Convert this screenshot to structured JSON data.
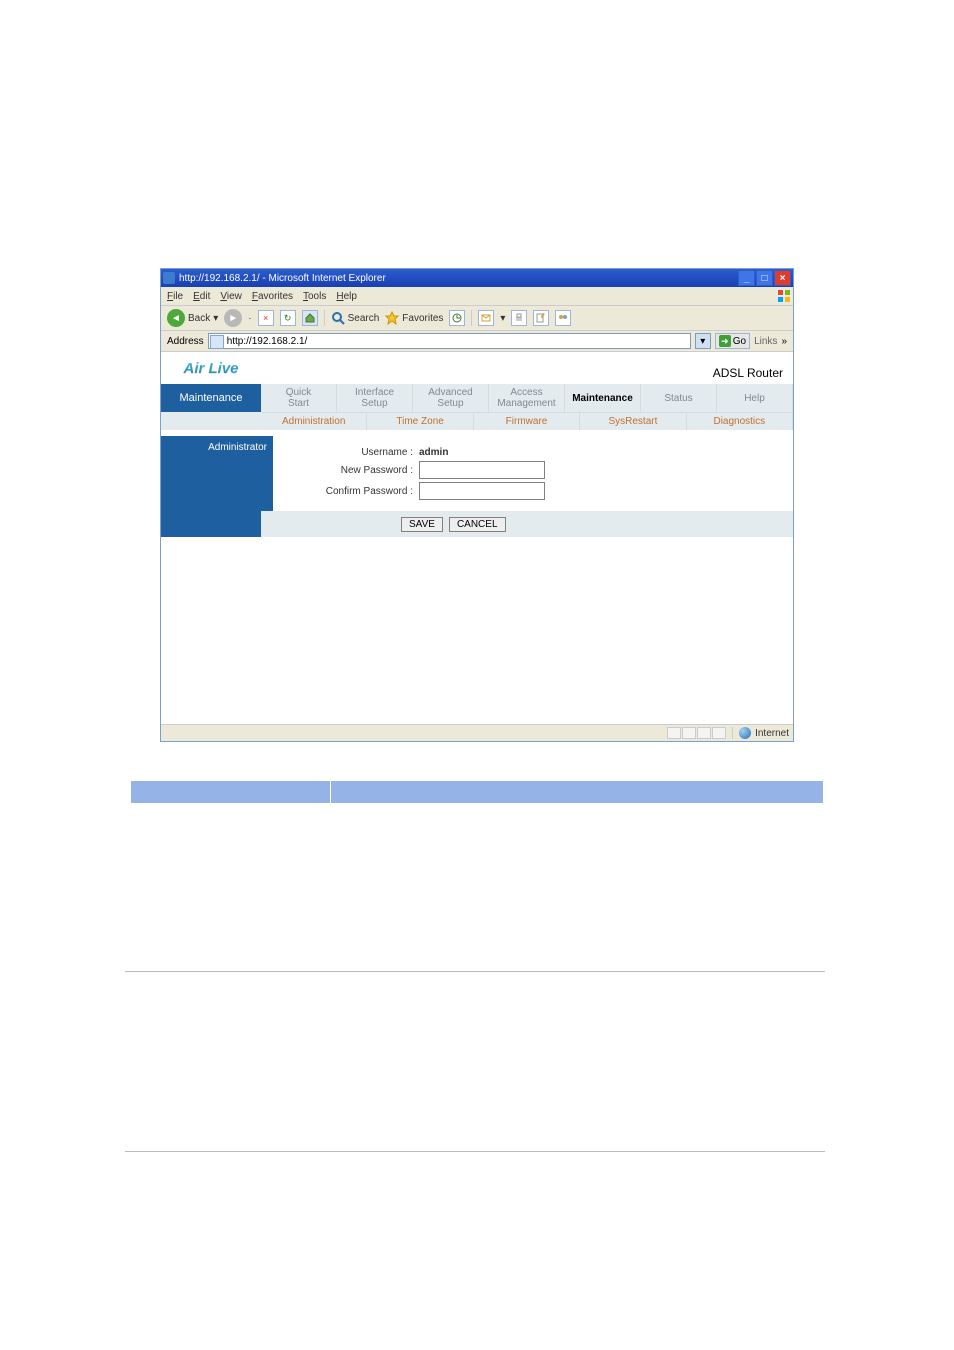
{
  "browser": {
    "window_title": "http://192.168.2.1/ - Microsoft Internet Explorer",
    "menu": {
      "file": "File",
      "edit": "Edit",
      "view": "View",
      "favorites": "Favorites",
      "tools": "Tools",
      "help": "Help"
    },
    "toolbar": {
      "back": "Back",
      "search": "Search",
      "favorites": "Favorites"
    },
    "address_label": "Address",
    "address_value": "http://192.168.2.1/",
    "go": "Go",
    "links": "Links",
    "status": {
      "zone": "Internet"
    }
  },
  "router": {
    "logo": "Air Live",
    "product": "ADSL Router",
    "section": "Maintenance",
    "tabs": {
      "quick_start": "Quick\nStart",
      "interface_setup": "Interface\nSetup",
      "advanced_setup": "Advanced\nSetup",
      "access_management": "Access\nManagement",
      "maintenance": "Maintenance",
      "status": "Status",
      "help": "Help"
    },
    "subtabs": {
      "administration": "Administration",
      "time_zone": "Time Zone",
      "firmware": "Firmware",
      "sysrestart": "SysRestart",
      "diagnostics": "Diagnostics"
    },
    "panel_title": "Administrator",
    "form": {
      "username_label": "Username :",
      "username_value": "admin",
      "new_password_label": "New Password :",
      "confirm_password_label": "Confirm Password :"
    },
    "buttons": {
      "save": "SAVE",
      "cancel": "CANCEL"
    }
  }
}
